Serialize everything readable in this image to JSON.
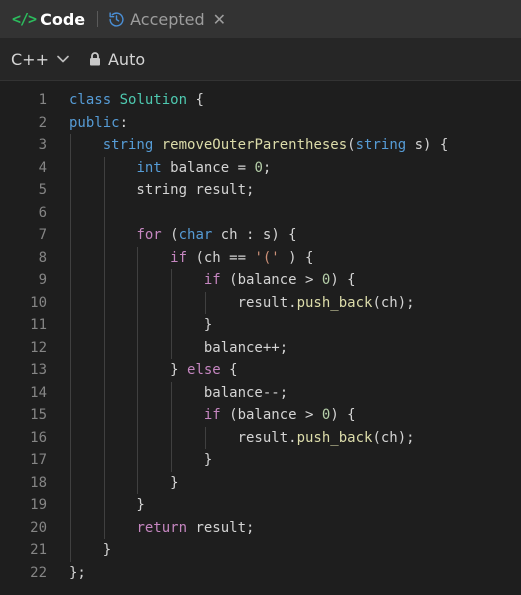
{
  "tabs": {
    "code_icon": "</>",
    "code_label": "Code",
    "accepted_label": "Accepted",
    "close_label": "✕"
  },
  "toolbar": {
    "language": "C++",
    "auto_label": "Auto"
  },
  "colors": {
    "code_icon": "#2cbb5d",
    "keyword": "#569cd6",
    "control": "#c586c0",
    "function": "#dcdcaa",
    "type": "#4ec9b0",
    "number": "#b5cea8",
    "string": "#ce9178"
  },
  "editor": {
    "lines": [
      {
        "n": "1",
        "tokens": [
          [
            "kw",
            "class"
          ],
          [
            "p",
            " "
          ],
          [
            "cls",
            "Solution"
          ],
          [
            "p",
            " {"
          ]
        ]
      },
      {
        "n": "2",
        "tokens": [
          [
            "kw",
            "public"
          ],
          [
            "p",
            ":"
          ]
        ]
      },
      {
        "n": "3",
        "tokens": [
          [
            "p",
            "    "
          ],
          [
            "kw",
            "string"
          ],
          [
            "p",
            " "
          ],
          [
            "fn",
            "removeOuterParentheses"
          ],
          [
            "p",
            "("
          ],
          [
            "kw",
            "string"
          ],
          [
            "p",
            " s) {"
          ]
        ]
      },
      {
        "n": "4",
        "tokens": [
          [
            "p",
            "        "
          ],
          [
            "kw",
            "int"
          ],
          [
            "p",
            " balance = "
          ],
          [
            "num",
            "0"
          ],
          [
            "p",
            ";"
          ]
        ]
      },
      {
        "n": "5",
        "tokens": [
          [
            "p",
            "        string result;"
          ]
        ]
      },
      {
        "n": "6",
        "tokens": []
      },
      {
        "n": "7",
        "tokens": [
          [
            "p",
            "        "
          ],
          [
            "ctrl",
            "for"
          ],
          [
            "p",
            " ("
          ],
          [
            "kw",
            "char"
          ],
          [
            "p",
            " ch : s) {"
          ]
        ]
      },
      {
        "n": "8",
        "tokens": [
          [
            "p",
            "            "
          ],
          [
            "ctrl",
            "if"
          ],
          [
            "p",
            " (ch == "
          ],
          [
            "str",
            "'('"
          ],
          [
            "p",
            " ) {"
          ]
        ]
      },
      {
        "n": "9",
        "tokens": [
          [
            "p",
            "                "
          ],
          [
            "ctrl",
            "if"
          ],
          [
            "p",
            " (balance > "
          ],
          [
            "num",
            "0"
          ],
          [
            "p",
            ") {"
          ]
        ]
      },
      {
        "n": "10",
        "tokens": [
          [
            "p",
            "                    result."
          ],
          [
            "fn",
            "push_back"
          ],
          [
            "p",
            "(ch);"
          ]
        ]
      },
      {
        "n": "11",
        "tokens": [
          [
            "p",
            "                }"
          ]
        ]
      },
      {
        "n": "12",
        "tokens": [
          [
            "p",
            "                balance++;"
          ]
        ]
      },
      {
        "n": "13",
        "tokens": [
          [
            "p",
            "            } "
          ],
          [
            "ctrl",
            "else"
          ],
          [
            "p",
            " {"
          ]
        ]
      },
      {
        "n": "14",
        "tokens": [
          [
            "p",
            "                balance--;"
          ]
        ]
      },
      {
        "n": "15",
        "tokens": [
          [
            "p",
            "                "
          ],
          [
            "ctrl",
            "if"
          ],
          [
            "p",
            " (balance > "
          ],
          [
            "num",
            "0"
          ],
          [
            "p",
            ") {"
          ]
        ]
      },
      {
        "n": "16",
        "tokens": [
          [
            "p",
            "                    result."
          ],
          [
            "fn",
            "push_back"
          ],
          [
            "p",
            "(ch);"
          ]
        ]
      },
      {
        "n": "17",
        "tokens": [
          [
            "p",
            "                }"
          ]
        ]
      },
      {
        "n": "18",
        "tokens": [
          [
            "p",
            "            }"
          ]
        ]
      },
      {
        "n": "19",
        "tokens": [
          [
            "p",
            "        }"
          ]
        ]
      },
      {
        "n": "20",
        "tokens": [
          [
            "p",
            "        "
          ],
          [
            "ctrl",
            "return"
          ],
          [
            "p",
            " result;"
          ]
        ]
      },
      {
        "n": "21",
        "tokens": [
          [
            "p",
            "    }"
          ]
        ]
      },
      {
        "n": "22",
        "tokens": [
          [
            "p",
            "};"
          ]
        ]
      }
    ]
  }
}
